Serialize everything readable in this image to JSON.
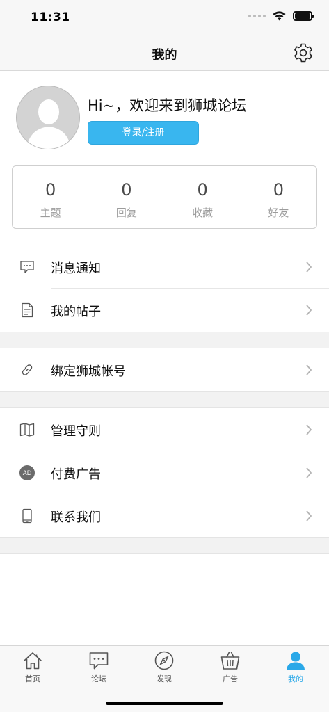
{
  "status_bar": {
    "time": "11:31"
  },
  "nav": {
    "title": "我的"
  },
  "profile": {
    "greeting": "Hi~，欢迎来到狮城论坛",
    "login_label": "登录/注册"
  },
  "stats": [
    {
      "value": "0",
      "label": "主题"
    },
    {
      "value": "0",
      "label": "回复"
    },
    {
      "value": "0",
      "label": "收藏"
    },
    {
      "value": "0",
      "label": "好友"
    }
  ],
  "menu": {
    "notifications": "消息通知",
    "my_posts": "我的帖子",
    "bind_account": "绑定狮城帐号",
    "rules": "管理守则",
    "paid_ads": "付费广告",
    "ad_badge": "AD",
    "contact": "联系我们"
  },
  "tabs": [
    {
      "label": "首页",
      "icon": "home-icon"
    },
    {
      "label": "论坛",
      "icon": "forum-chat-icon"
    },
    {
      "label": "发现",
      "icon": "compass-icon"
    },
    {
      "label": "广告",
      "icon": "basket-icon"
    },
    {
      "label": "我的",
      "icon": "profile-icon"
    }
  ],
  "colors": {
    "accent": "#39b6ef",
    "active_tab": "#2aa8e8"
  }
}
